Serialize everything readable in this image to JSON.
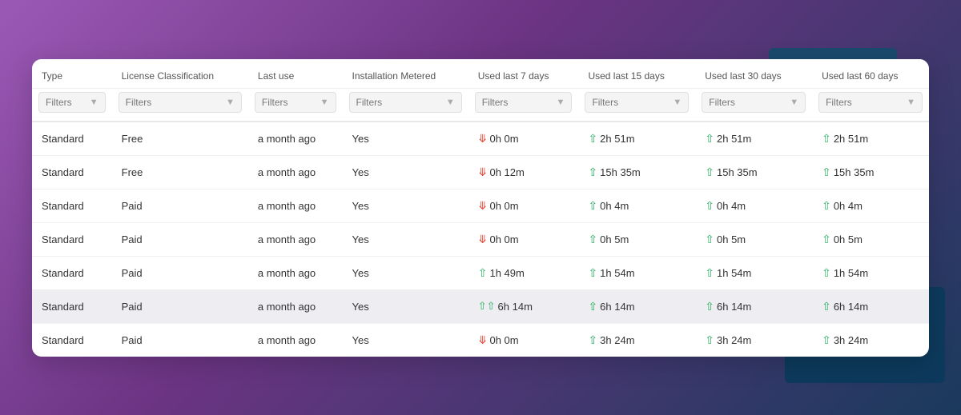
{
  "background": {
    "color1": "#9b59b6",
    "color2": "#1a3a5c"
  },
  "table": {
    "headers": [
      "Type",
      "License Classification",
      "Last use",
      "Installation Metered",
      "Used last 7 days",
      "Used last 15 days",
      "Used last 30 days",
      "Used last 60 days"
    ],
    "filter_label": "Filters",
    "rows": [
      {
        "type": "Standard",
        "license": "Free",
        "last_use": "a month ago",
        "metered": "Yes",
        "d7": {
          "icon": "down-red",
          "value": "0h 0m"
        },
        "d15": {
          "icon": "up-green",
          "value": "2h 51m"
        },
        "d30": {
          "icon": "up-green",
          "value": "2h 51m"
        },
        "d60": {
          "icon": "up-green",
          "value": "2h 51m"
        },
        "highlighted": false
      },
      {
        "type": "Standard",
        "license": "Free",
        "last_use": "a month ago",
        "metered": "Yes",
        "d7": {
          "icon": "down-red",
          "value": "0h 12m"
        },
        "d15": {
          "icon": "up-green",
          "value": "15h 35m"
        },
        "d30": {
          "icon": "up-green",
          "value": "15h 35m"
        },
        "d60": {
          "icon": "up-green",
          "value": "15h 35m"
        },
        "highlighted": false
      },
      {
        "type": "Standard",
        "license": "Paid",
        "last_use": "a month ago",
        "metered": "Yes",
        "d7": {
          "icon": "down-red",
          "value": "0h 0m"
        },
        "d15": {
          "icon": "up-green",
          "value": "0h 4m"
        },
        "d30": {
          "icon": "up-green",
          "value": "0h 4m"
        },
        "d60": {
          "icon": "up-green",
          "value": "0h 4m"
        },
        "highlighted": false
      },
      {
        "type": "Standard",
        "license": "Paid",
        "last_use": "a month ago",
        "metered": "Yes",
        "d7": {
          "icon": "down-red",
          "value": "0h 0m"
        },
        "d15": {
          "icon": "up-green",
          "value": "0h 5m"
        },
        "d30": {
          "icon": "up-green",
          "value": "0h 5m"
        },
        "d60": {
          "icon": "up-green",
          "value": "0h 5m"
        },
        "highlighted": false
      },
      {
        "type": "Standard",
        "license": "Paid",
        "last_use": "a month ago",
        "metered": "Yes",
        "d7": {
          "icon": "up-green",
          "value": "1h 49m"
        },
        "d15": {
          "icon": "up-green",
          "value": "1h 54m"
        },
        "d30": {
          "icon": "up-green",
          "value": "1h 54m"
        },
        "d60": {
          "icon": "up-green",
          "value": "1h 54m"
        },
        "highlighted": false
      },
      {
        "type": "Standard",
        "license": "Paid",
        "last_use": "a month ago",
        "metered": "Yes",
        "d7": {
          "icon": "double-up-green",
          "value": "6h 14m"
        },
        "d15": {
          "icon": "up-green",
          "value": "6h 14m"
        },
        "d30": {
          "icon": "up-green",
          "value": "6h 14m"
        },
        "d60": {
          "icon": "up-green",
          "value": "6h 14m"
        },
        "highlighted": true
      },
      {
        "type": "Standard",
        "license": "Paid",
        "last_use": "a month ago",
        "metered": "Yes",
        "d7": {
          "icon": "down-red",
          "value": "0h 0m"
        },
        "d15": {
          "icon": "up-green",
          "value": "3h 24m"
        },
        "d30": {
          "icon": "up-green",
          "value": "3h 24m"
        },
        "d60": {
          "icon": "up-green",
          "value": "3h 24m"
        },
        "highlighted": false
      }
    ]
  }
}
